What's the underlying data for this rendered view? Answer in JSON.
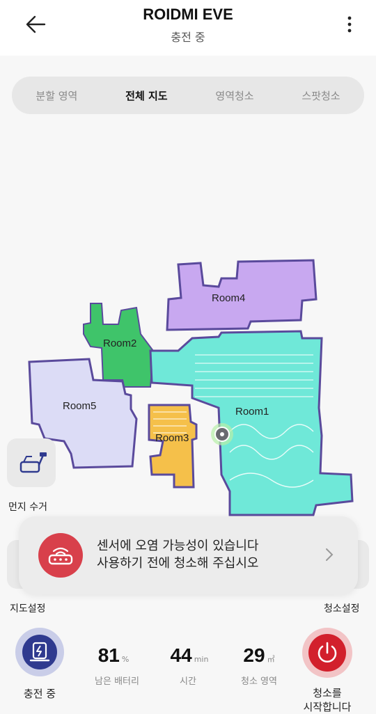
{
  "header": {
    "title": "ROIDMI EVE",
    "status": "충전 중"
  },
  "tabs": [
    {
      "label": "분할 영역",
      "active": false
    },
    {
      "label": "전체 지도",
      "active": true
    },
    {
      "label": "영역청소",
      "active": false
    },
    {
      "label": "스팟청소",
      "active": false
    }
  ],
  "map": {
    "rooms": [
      {
        "label": "Room1",
        "color": "#6fe8d8"
      },
      {
        "label": "Room2",
        "color": "#3fc46a"
      },
      {
        "label": "Room3",
        "color": "#f5c04a"
      },
      {
        "label": "Room4",
        "color": "#c8a8f0"
      },
      {
        "label": "Room5",
        "color": "#dcdcf6"
      }
    ],
    "wall_color": "#5a4a9c"
  },
  "side": {
    "dust_label": "먼지 수거",
    "map_settings_label": "지도설정",
    "clean_settings_label": "청소설정"
  },
  "toast": {
    "line1": "센서에 오염 가능성이 있습니다",
    "line2": "사용하기 전에 청소해 주십시오",
    "icon": "sensor-icon",
    "accent": "#d8404b"
  },
  "bottom": {
    "charge_label": "충전 중",
    "start_label_line1": "청소를",
    "start_label_line2": "시작합니다",
    "battery": {
      "value": "81",
      "unit": "%",
      "label": "남은 배터리"
    },
    "time": {
      "value": "44",
      "unit": "min",
      "label": "시간"
    },
    "area": {
      "value": "29",
      "unit": "㎡",
      "label": "청소 영역"
    },
    "power_color": "#d2202c",
    "charge_color": "#2f3a8f"
  }
}
